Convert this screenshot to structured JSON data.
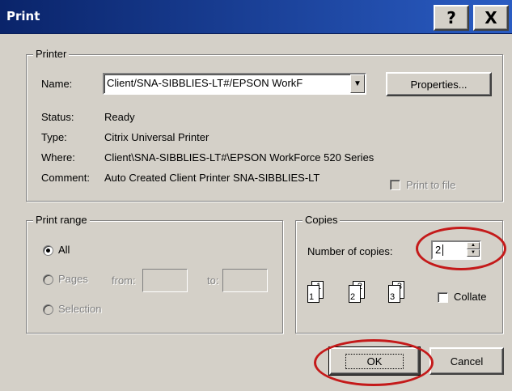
{
  "window": {
    "title": "Print",
    "help_label": "?",
    "close_label": "X"
  },
  "printer": {
    "legend": "Printer",
    "name_label": "Name:",
    "name_value": "Client/SNA-SIBBLIES-LT#/EPSON WorkF",
    "properties_label": "Properties...",
    "status_label": "Status:",
    "status_value": "Ready",
    "type_label": "Type:",
    "type_value": "Citrix Universal Printer",
    "where_label": "Where:",
    "where_value": "Client\\SNA-SIBBLIES-LT#\\EPSON WorkForce 520 Series",
    "comment_label": "Comment:",
    "comment_value": "Auto Created Client Printer SNA-SIBBLIES-LT",
    "print_to_file_label": "Print to file"
  },
  "print_range": {
    "legend": "Print range",
    "all_label": "All",
    "pages_label": "Pages",
    "from_label": "from:",
    "to_label": "to:",
    "selection_label": "Selection"
  },
  "copies": {
    "legend": "Copies",
    "number_label": "Number of copies:",
    "number_value": "2",
    "collate_label": "Collate",
    "page_numbers": [
      "1",
      "1",
      "2",
      "2",
      "3",
      "3"
    ]
  },
  "buttons": {
    "ok_label": "OK",
    "cancel_label": "Cancel"
  },
  "colors": {
    "titlebar": "#0a246a",
    "dialog_face": "#d4d0c8",
    "annotation_circle": "#c41a1a"
  }
}
